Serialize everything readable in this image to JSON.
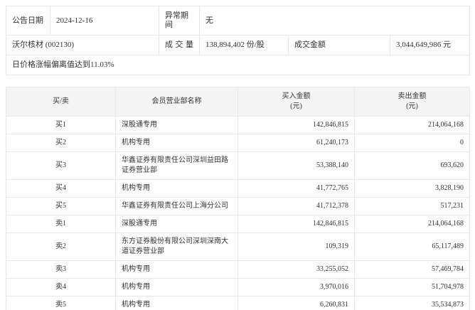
{
  "page": {
    "background": "#ffffff",
    "border_color": "#e8e8e8",
    "table_header_bg": "#f4f4f4",
    "text_color": "#333333"
  },
  "info": {
    "announce_date_label": "公告日期",
    "announce_date": "2024-12-16",
    "abnormal_period_label": "异常期间",
    "abnormal_period": "无",
    "stock": "沃尔核材 (002130)",
    "volume_label": "成交量",
    "volume": "138,894,402 份/股",
    "turnover_label": "成交金额",
    "turnover": "3,044,649,986 元",
    "deviation_note": "日价格涨幅偏离值达到11.03%"
  },
  "table": {
    "headers": {
      "side": "买/卖",
      "broker": "会员营业部名称",
      "buy": "买入金额",
      "buy_unit": "(元)",
      "sell": "卖出金额",
      "sell_unit": "(元)"
    },
    "rows": [
      {
        "side": "买1",
        "broker": "深股通专用",
        "buy": "142,846,815",
        "sell": "214,064,168"
      },
      {
        "side": "买2",
        "broker": "机构专用",
        "buy": "61,240,173",
        "sell": "0"
      },
      {
        "side": "买3",
        "broker": "华鑫证券有限责任公司深圳益田路证券营业部",
        "buy": "53,388,140",
        "sell": "693,620"
      },
      {
        "side": "买4",
        "broker": "机构专用",
        "buy": "41,772,765",
        "sell": "3,828,190"
      },
      {
        "side": "买5",
        "broker": "华鑫证券有限责任公司上海分公司",
        "buy": "41,712,378",
        "sell": "517,231"
      },
      {
        "side": "卖1",
        "broker": "深股通专用",
        "buy": "142,846,815",
        "sell": "214,064,168"
      },
      {
        "side": "卖2",
        "broker": "东方证券股份有限公司深圳深南大道证券营业部",
        "buy": "109,319",
        "sell": "65,117,489"
      },
      {
        "side": "卖3",
        "broker": "机构专用",
        "buy": "33,255,052",
        "sell": "57,469,784"
      },
      {
        "side": "卖4",
        "broker": "机构专用",
        "buy": "3,970,016",
        "sell": "51,704,978"
      },
      {
        "side": "卖5",
        "broker": "机构专用",
        "buy": "6,260,831",
        "sell": "35,534,873"
      }
    ]
  }
}
